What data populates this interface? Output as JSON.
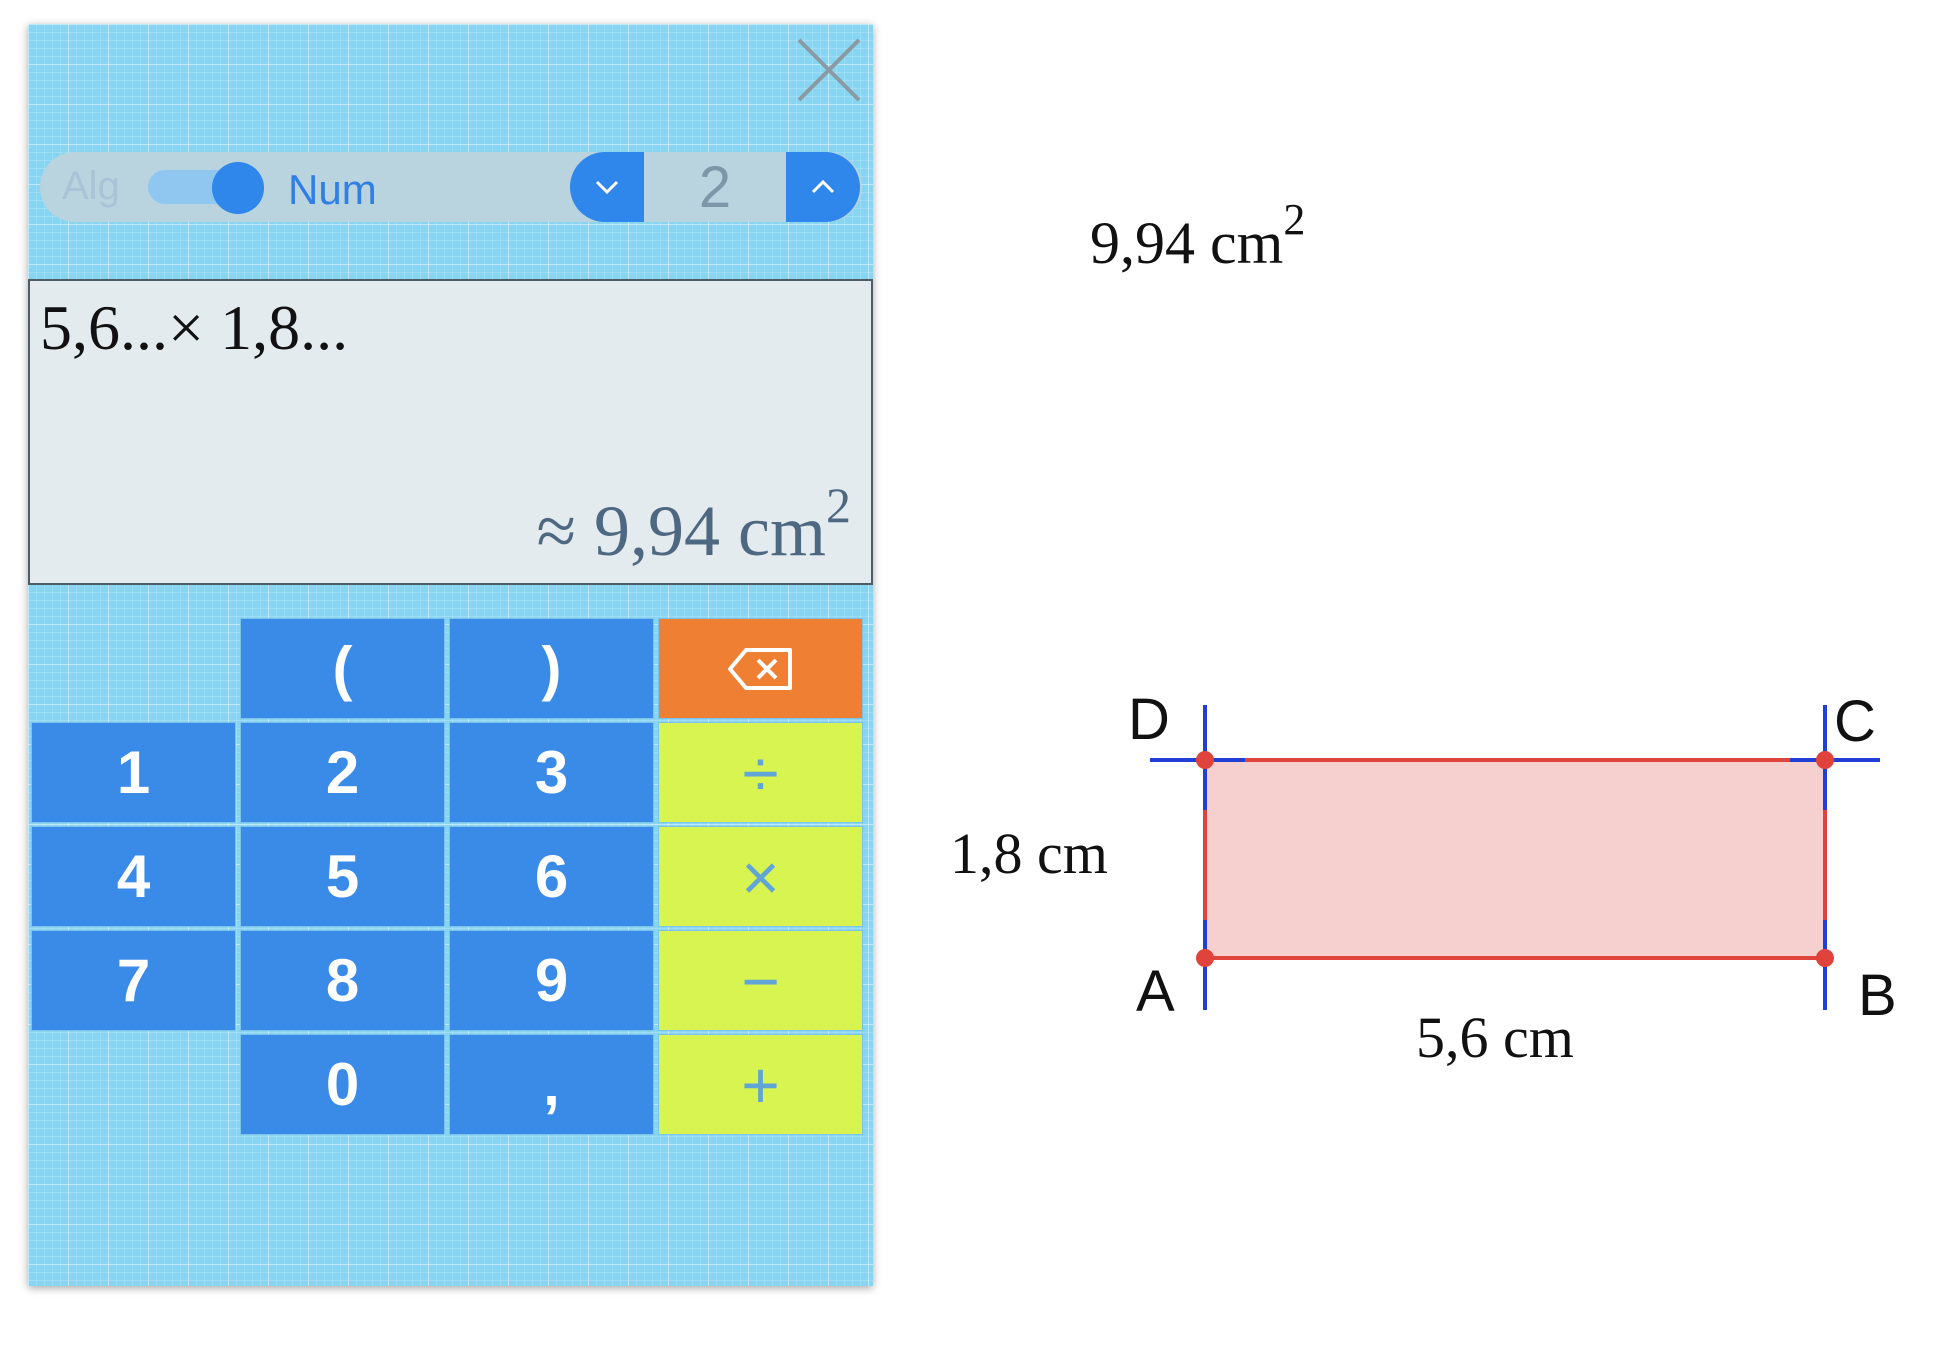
{
  "calculator": {
    "close_icon": "close-icon",
    "mode": {
      "left_label": "Alg",
      "right_label": "Num",
      "active": "Num"
    },
    "precision": {
      "value": "2",
      "decrease_icon": "chevron-down-icon",
      "increase_icon": "chevron-up-icon"
    },
    "display": {
      "expression": "5,6...× 1,8...",
      "result_prefix": "≈ ",
      "result_value": "9,94 cm",
      "result_exponent": "2"
    },
    "keys": {
      "open_paren": "(",
      "close_paren": ")",
      "backspace_icon": "backspace-icon",
      "k1": "1",
      "k2": "2",
      "k3": "3",
      "k4": "4",
      "k5": "5",
      "k6": "6",
      "k7": "7",
      "k8": "8",
      "k9": "9",
      "k0": "0",
      "comma": ",",
      "divide": "÷",
      "multiply": "×",
      "minus": "−",
      "plus": "+"
    },
    "colors": {
      "panel": "#86d6f3",
      "number_key": "#3a8ae8",
      "operator_key": "#d8f450",
      "backspace_key": "#ef8033"
    }
  },
  "geometry": {
    "area_text": "9,94 cm",
    "area_exponent": "2",
    "points": {
      "A": "A",
      "B": "B",
      "C": "C",
      "D": "D"
    },
    "width_label": "5,6 cm",
    "height_label": "1,8 cm",
    "colors": {
      "rectangle_fill": "#f6cfcf",
      "rectangle_stroke": "#e0433b",
      "axis_lines": "#1f3fd6"
    }
  }
}
